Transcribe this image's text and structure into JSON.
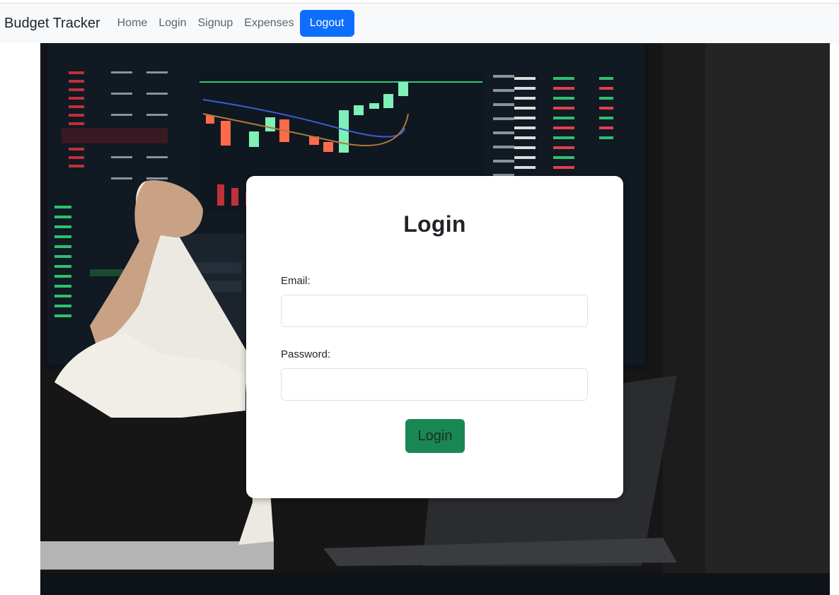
{
  "navbar": {
    "brand": "Budget Tracker",
    "links": [
      "Home",
      "Login",
      "Signup",
      "Expenses"
    ],
    "logout_label": "Logout",
    "logout_color": "#0d6efd"
  },
  "login_form": {
    "title": "Login",
    "email_label": "Email:",
    "email_value": "",
    "password_label": "Password:",
    "password_value": "",
    "submit_label": "Login",
    "submit_color": "#198754"
  },
  "background": {
    "description_icon": "trading-screen-photo"
  }
}
